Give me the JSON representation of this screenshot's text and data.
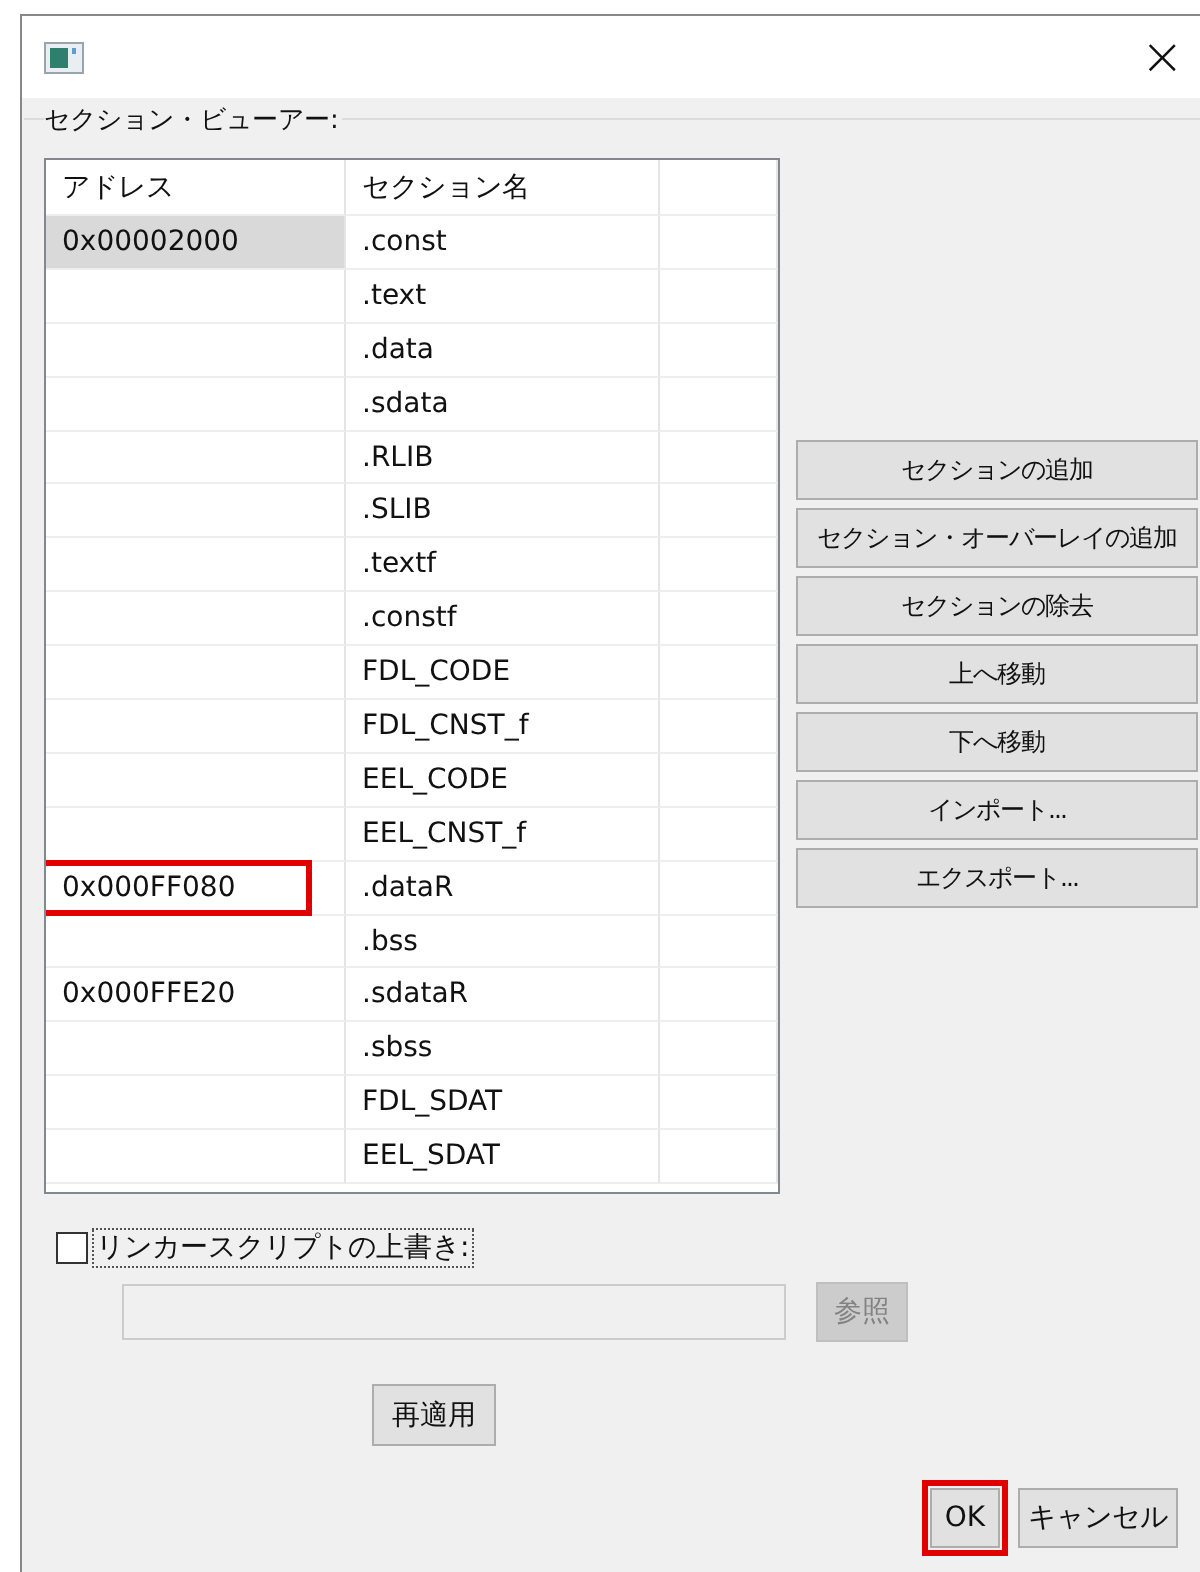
{
  "window": {
    "close": "×"
  },
  "section_viewer": {
    "label": "セクション・ビューアー:",
    "columns": [
      "アドレス",
      "セクション名"
    ],
    "rows": [
      {
        "address": "0x00002000",
        "section": ".const",
        "selected": true,
        "highlighted": false
      },
      {
        "address": "",
        "section": ".text",
        "selected": false,
        "highlighted": false
      },
      {
        "address": "",
        "section": ".data",
        "selected": false,
        "highlighted": false
      },
      {
        "address": "",
        "section": ".sdata",
        "selected": false,
        "highlighted": false
      },
      {
        "address": "",
        "section": ".RLIB",
        "selected": false,
        "highlighted": false
      },
      {
        "address": "",
        "section": ".SLIB",
        "selected": false,
        "highlighted": false
      },
      {
        "address": "",
        "section": ".textf",
        "selected": false,
        "highlighted": false
      },
      {
        "address": "",
        "section": ".constf",
        "selected": false,
        "highlighted": false
      },
      {
        "address": "",
        "section": "FDL_CODE",
        "selected": false,
        "highlighted": false
      },
      {
        "address": "",
        "section": "FDL_CNST_f",
        "selected": false,
        "highlighted": false
      },
      {
        "address": "",
        "section": "EEL_CODE",
        "selected": false,
        "highlighted": false
      },
      {
        "address": "",
        "section": "EEL_CNST_f",
        "selected": false,
        "highlighted": false
      },
      {
        "address": "0x000FF080",
        "section": ".dataR",
        "selected": false,
        "highlighted": true
      },
      {
        "address": "",
        "section": ".bss",
        "selected": false,
        "highlighted": false
      },
      {
        "address": "0x000FFE20",
        "section": ".sdataR",
        "selected": false,
        "highlighted": false
      },
      {
        "address": "",
        "section": ".sbss",
        "selected": false,
        "highlighted": false
      },
      {
        "address": "",
        "section": "FDL_SDAT",
        "selected": false,
        "highlighted": false
      },
      {
        "address": "",
        "section": "EEL_SDAT",
        "selected": false,
        "highlighted": false
      }
    ],
    "buttons": [
      "セクションの追加",
      "セクション・オーバーレイの追加",
      "セクションの除去",
      "上へ移動",
      "下へ移動",
      "インポート...",
      "エクスポート..."
    ]
  },
  "override": {
    "label": "リンカースクリプトの上書き:",
    "checked": false,
    "browse": {
      "label": "参照",
      "disabled": true
    },
    "path_disabled": true
  },
  "reapply": "再適用",
  "footer": [
    {
      "label": "OK",
      "highlighted": true
    },
    {
      "label": "キャンセル",
      "highlighted": false
    }
  ]
}
